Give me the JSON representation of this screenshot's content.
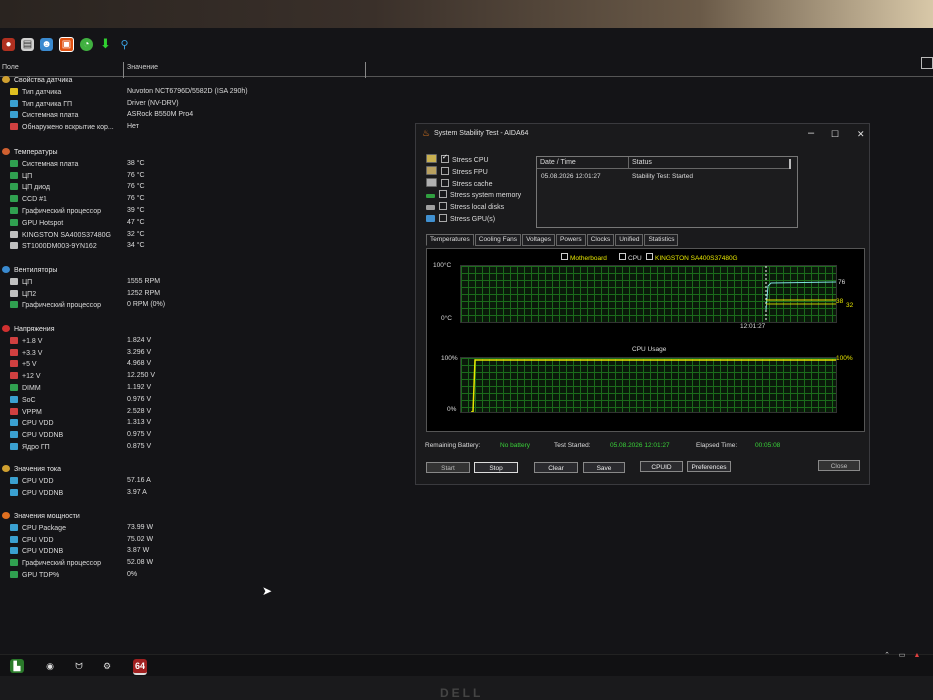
{
  "toolbar": {
    "icons": [
      "search-icon",
      "folder-icon",
      "user-icon",
      "chip-icon",
      "clock-icon",
      "down-arrow-icon",
      "magnifier-icon"
    ]
  },
  "columns": {
    "field": "Поле",
    "value": "Значение"
  },
  "tree": {
    "groups": [
      {
        "title": "Свойства датчика",
        "items": [
          {
            "name": "Тип датчика",
            "value": "Nuvoton NCT6796D/5582D  (ISA 290h)"
          },
          {
            "name": "Тип датчика ГП",
            "value": "Driver  (NV-DRV)"
          },
          {
            "name": "Системная плата",
            "value": "ASRock B550M Pro4"
          },
          {
            "name": "Обнаружено вскрытие кор...",
            "value": "Нет"
          }
        ]
      },
      {
        "title": "Температуры",
        "items": [
          {
            "name": "Системная плата",
            "value": "38 °C"
          },
          {
            "name": "ЦП",
            "value": "76 °C"
          },
          {
            "name": "ЦП диод",
            "value": "76 °C"
          },
          {
            "name": "CCD #1",
            "value": "76 °C"
          },
          {
            "name": "Графический процессор",
            "value": "39 °C"
          },
          {
            "name": "GPU Hotspot",
            "value": "47 °C"
          },
          {
            "name": "KINGSTON SA400S37480G",
            "value": "32 °C"
          },
          {
            "name": "ST1000DM003-9YN162",
            "value": "34 °C"
          }
        ]
      },
      {
        "title": "Вентиляторы",
        "items": [
          {
            "name": "ЦП",
            "value": "1555 RPM"
          },
          {
            "name": "ЦП2",
            "value": "1252 RPM"
          },
          {
            "name": "Графический процессор",
            "value": "0 RPM  (0%)"
          }
        ]
      },
      {
        "title": "Напряжения",
        "items": [
          {
            "name": "+1.8 V",
            "value": "1.824 V"
          },
          {
            "name": "+3.3 V",
            "value": "3.296 V"
          },
          {
            "name": "+5 V",
            "value": "4.968 V"
          },
          {
            "name": "+12 V",
            "value": "12.250 V"
          },
          {
            "name": "DIMM",
            "value": "1.192 V"
          },
          {
            "name": "SoC",
            "value": "0.976 V"
          },
          {
            "name": "VPPM",
            "value": "2.528 V"
          },
          {
            "name": "CPU VDD",
            "value": "1.313 V"
          },
          {
            "name": "CPU VDDNB",
            "value": "0.975 V"
          },
          {
            "name": "Ядро ГП",
            "value": "0.875 V"
          }
        ]
      },
      {
        "title": "Значения тока",
        "items": [
          {
            "name": "CPU VDD",
            "value": "57.16 A"
          },
          {
            "name": "CPU VDDNB",
            "value": "3.97 A"
          }
        ]
      },
      {
        "title": "Значения мощности",
        "items": [
          {
            "name": "CPU Package",
            "value": "73.99 W"
          },
          {
            "name": "CPU VDD",
            "value": "75.02 W"
          },
          {
            "name": "CPU VDDNB",
            "value": "3.87 W"
          },
          {
            "name": "Графический процессор",
            "value": "52.08 W"
          },
          {
            "name": "GPU TDP%",
            "value": "0%"
          }
        ]
      }
    ]
  },
  "sst": {
    "title": "System Stability Test - AIDA64",
    "controls": {
      "min": "–",
      "max": "☐",
      "close": "✕"
    },
    "stress": [
      {
        "label": "Stress CPU",
        "checked": true
      },
      {
        "label": "Stress FPU",
        "checked": false
      },
      {
        "label": "Stress cache",
        "checked": false
      },
      {
        "label": "Stress system memory",
        "checked": false
      },
      {
        "label": "Stress local disks",
        "checked": false
      },
      {
        "label": "Stress GPU(s)",
        "checked": false
      }
    ],
    "log": {
      "col_date": "Date / Time",
      "col_status": "Status",
      "date": "05.08.2026 12:01:27",
      "status": "Stability Test: Started"
    },
    "tabs": [
      "Temperatures",
      "Cooling Fans",
      "Voltages",
      "Powers",
      "Clocks",
      "Unified",
      "Statistics"
    ],
    "temp_chart": {
      "legend": [
        "Motherboard",
        "CPU",
        "KINGSTON SA400S37480G"
      ],
      "y_top": "100°C",
      "y_bottom": "0°C",
      "x_label": "12:01:27",
      "val_cpu": "76",
      "val_mb": "38",
      "val_ssd": "32"
    },
    "usage_chart": {
      "title": "CPU Usage",
      "y_top": "100%",
      "y_bottom": "0%",
      "val": "100%"
    },
    "status": {
      "battery_label": "Remaining Battery:",
      "battery_value": "No battery",
      "started_label": "Test Started:",
      "started_value": "05.08.2026 12:01:27",
      "elapsed_label": "Elapsed Time:",
      "elapsed_value": "00:05:08"
    },
    "buttons": {
      "start": "Start",
      "stop": "Stop",
      "clear": "Clear",
      "save": "Save",
      "cpuid": "CPUID",
      "prefs": "Preferences",
      "close": "Close"
    }
  },
  "taskbar": {
    "badge": "64"
  },
  "brand": "DELL",
  "colors": {
    "green": "#39d239",
    "yellow": "#e8e800",
    "grid": "#1b6b1b",
    "cyan": "#7fe0e0"
  }
}
